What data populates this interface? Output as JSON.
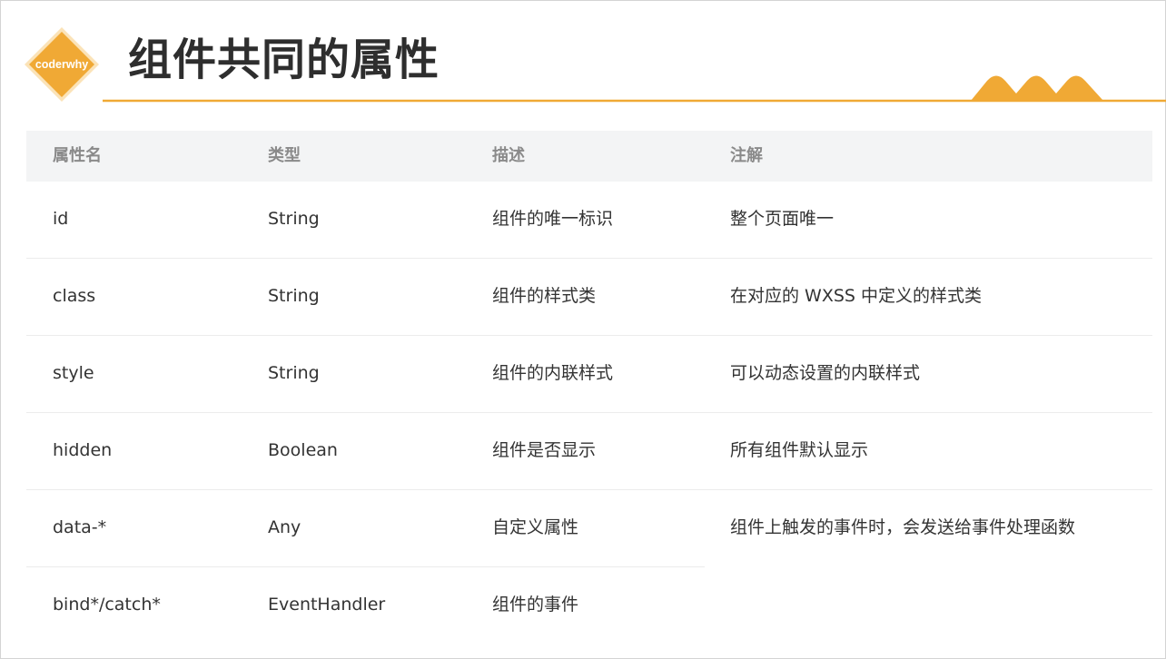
{
  "logo": {
    "text": "coderwhy"
  },
  "title": "组件共同的属性",
  "colors": {
    "accent": "#f0a935",
    "accent_light": "#f7c25a",
    "title": "#2e2e2e",
    "header_bg": "#f3f4f5",
    "header_text": "#8a8a8a",
    "body_text": "#333333",
    "row_border": "#ececec"
  },
  "table": {
    "columns": [
      "属性名",
      "类型",
      "描述",
      "注解"
    ],
    "rows": [
      {
        "name": "id",
        "type": "String",
        "desc": "组件的唯一标识",
        "note": "整个页面唯一"
      },
      {
        "name": "class",
        "type": "String",
        "desc": "组件的样式类",
        "note": "在对应的 WXSS 中定义的样式类"
      },
      {
        "name": "style",
        "type": "String",
        "desc": "组件的内联样式",
        "note": "可以动态设置的内联样式"
      },
      {
        "name": "hidden",
        "type": "Boolean",
        "desc": "组件是否显示",
        "note": "所有组件默认显示"
      },
      {
        "name": "data-*",
        "type": "Any",
        "desc": "自定义属性",
        "note": "组件上触发的事件时，会发送给事件处理函数"
      },
      {
        "name": "bind*/catch*",
        "type": "EventHandler",
        "desc": "组件的事件",
        "note": ""
      }
    ]
  }
}
